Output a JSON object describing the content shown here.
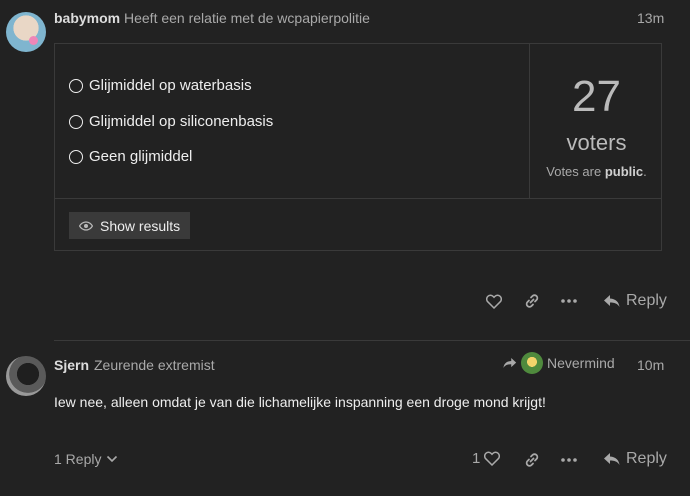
{
  "post1": {
    "username": "babymom",
    "user_title": "Heeft een relatie met de wcpapierpolitie",
    "time": "13m",
    "poll": {
      "options": [
        {
          "label": "Glijmiddel op waterbasis"
        },
        {
          "label": "Glijmiddel op siliconenbasis"
        },
        {
          "label": "Geen glijmiddel"
        }
      ],
      "voter_count": "27",
      "voters_label": "voters",
      "votes_prefix": "Votes are ",
      "votes_visibility": "public",
      "votes_suffix": ".",
      "show_results_label": "Show results"
    },
    "actions": {
      "reply_label": "Reply"
    }
  },
  "post2": {
    "username": "Sjern",
    "user_title": "Zeurende extremist",
    "reply_to_user": "Nevermind",
    "time": "10m",
    "body": "Iew nee, alleen omdat je van die lichamelijke inspanning een droge mond krijgt!",
    "replies_label": "1 Reply",
    "like_count": "1",
    "actions": {
      "reply_label": "Reply"
    }
  },
  "icons": {
    "like": "heart-icon",
    "link": "link-icon",
    "more": "ellipsis-icon",
    "reply": "reply-arrow-icon",
    "show": "eye-icon",
    "chevron": "chevron-down-icon"
  }
}
